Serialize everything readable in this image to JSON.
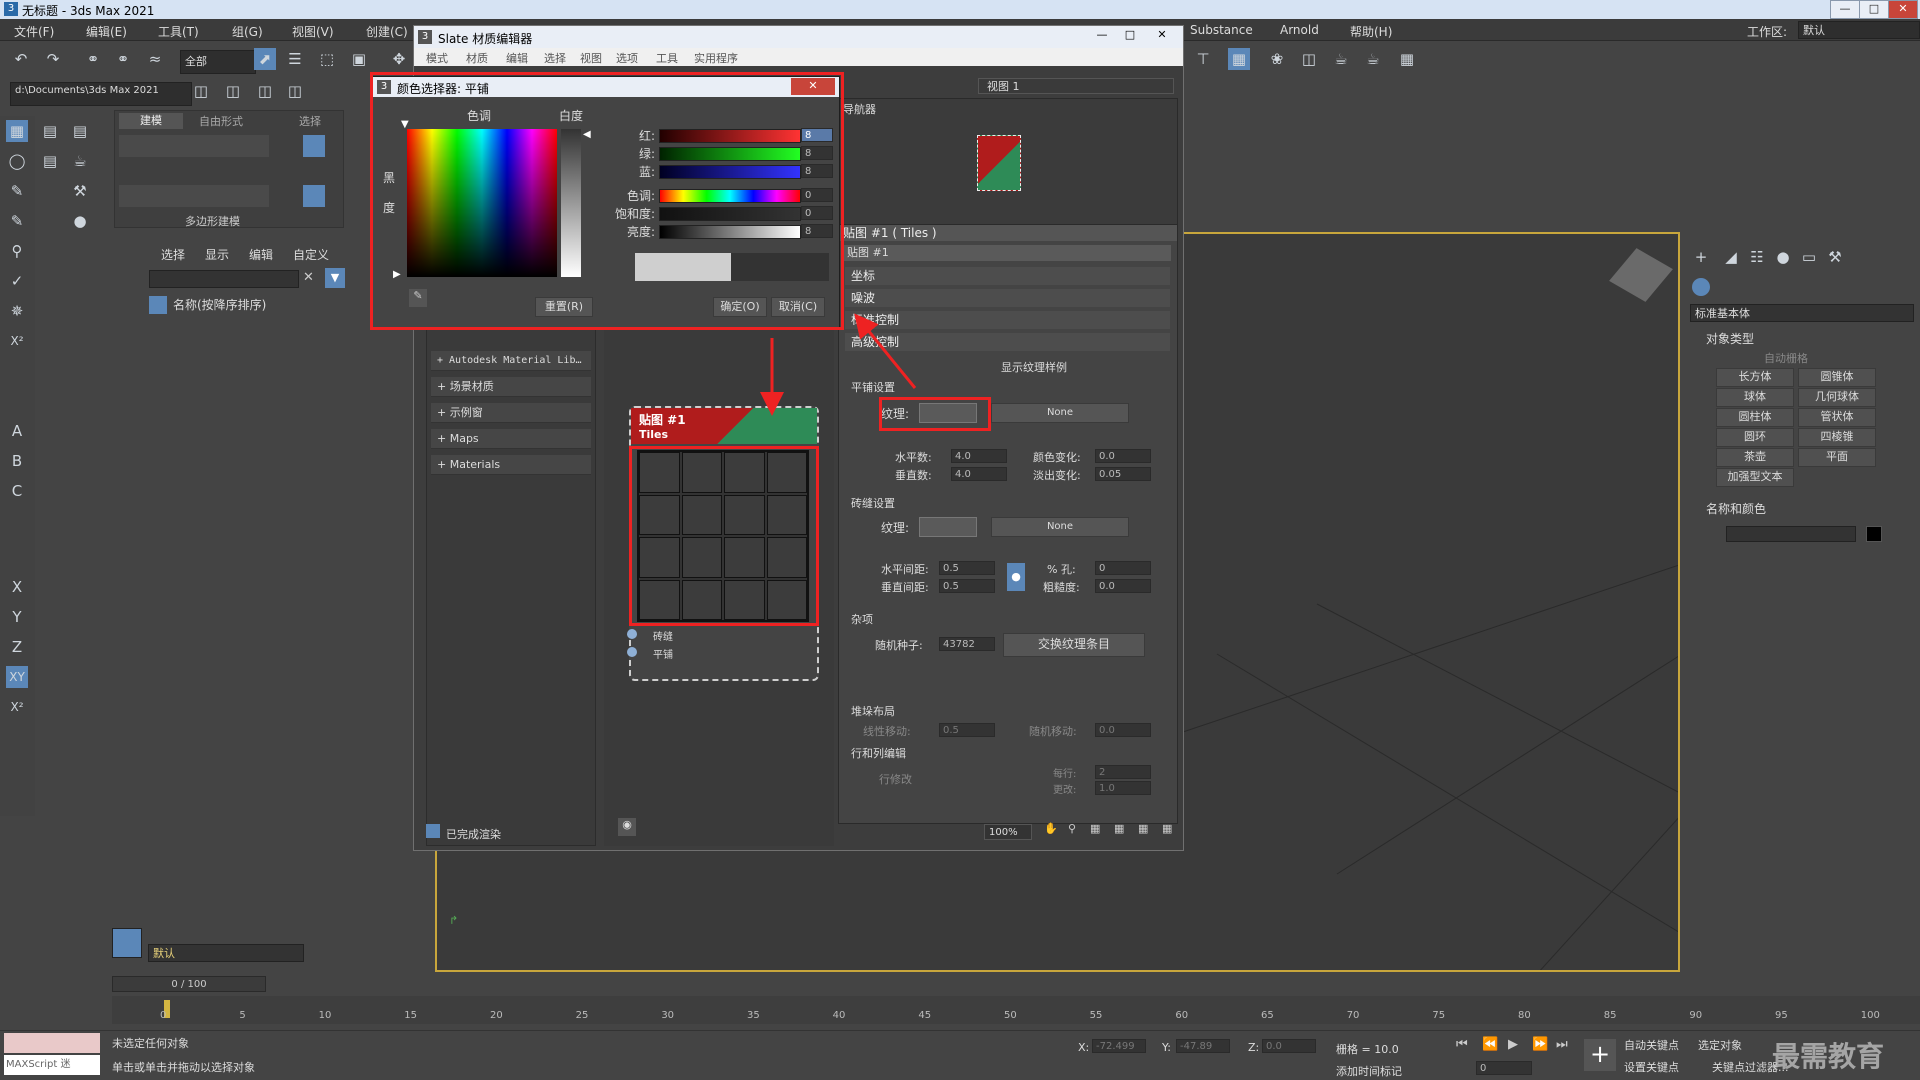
{
  "app": {
    "title": "无标题 - 3ds Max 2021",
    "workspace_label": "工作区:",
    "workspace_value": "默认"
  },
  "menu": [
    "文件(F)",
    "编辑(E)",
    "工具(T)",
    "组(G)",
    "视图(V)",
    "创建(C)",
    "Substance",
    "Arnold",
    "帮助(H)"
  ],
  "toolbar": {
    "selection_filter": "全部",
    "project_path": "d:\\Documents\\3ds Max 2021"
  },
  "ribbon": {
    "tabs": [
      "建模",
      "自由形式",
      "选择"
    ],
    "group_label": "多边形建模"
  },
  "explorer": {
    "tabs": [
      "选择",
      "显示",
      "编辑",
      "自定义"
    ],
    "column_header": "名称(按降序排序)",
    "layer": "默认"
  },
  "slate": {
    "title": "Slate 材质编辑器",
    "menu": [
      "模式",
      "材质",
      "编辑",
      "选择",
      "视图",
      "选项",
      "工具",
      "实用程序"
    ],
    "view_dropdown": "视图 1",
    "navigator_label": "导航器",
    "browser_items": [
      "+ Autodesk Material Lib…",
      "+ 场景材质",
      "+ 示例窗",
      "+ Maps",
      "+ Materials"
    ],
    "node": {
      "title": "贴图 #1",
      "subtitle": "Tiles",
      "slot1": "砖缝",
      "slot2": "平铺"
    },
    "status": "已完成渲染",
    "zoom": "100%"
  },
  "params": {
    "header": "贴图 #1 ( Tiles )",
    "map_name": "贴图 #1",
    "rollouts": [
      "坐标",
      "噪波",
      "标准控制",
      "高级控制"
    ],
    "show_texture_swatches": "显示纹理样例",
    "tile_setup": "平铺设置",
    "texture_label": "纹理:",
    "none_label": "None",
    "h_count_label": "水平数:",
    "h_count": "4.0",
    "v_count_label": "垂直数:",
    "v_count": "4.0",
    "color_var_label": "颜色变化:",
    "color_var": "0.0",
    "fade_var_label": "淡出变化:",
    "fade_var": "0.05",
    "grout_setup": "砖缝设置",
    "grout_texture_label": "纹理:",
    "h_gap_label": "水平间距:",
    "h_gap": "0.5",
    "v_gap_label": "垂直间距:",
    "v_gap": "0.5",
    "holes_label": "% 孔:",
    "holes": "0",
    "rough_label": "粗糙度:",
    "rough": "0.0",
    "misc": "杂项",
    "seed_label": "随机种子:",
    "seed": "43782",
    "swap_button": "交换纹理条目",
    "stacking": "堆垛布局",
    "line_shift_label": "线性移动:",
    "line_shift": "0.5",
    "random_shift_label": "随机移动:",
    "random_shift": "0.0",
    "row_col_edit": "行和列编辑",
    "row_modify": "行修改",
    "per_row_label": "每行:",
    "per_row": "2",
    "change_label": "更改:",
    "change": "1.0"
  },
  "color_picker": {
    "title": "颜色选择器: 平铺",
    "hue_label": "色调",
    "whiteness_label": "白度",
    "black_label_1": "黑",
    "black_label_2": "度",
    "channels": [
      {
        "label": "红:",
        "value": "8"
      },
      {
        "label": "绿:",
        "value": "8"
      },
      {
        "label": "蓝:",
        "value": "8"
      },
      {
        "label": "色调:",
        "value": "0"
      },
      {
        "label": "饱和度:",
        "value": "0"
      },
      {
        "label": "亮度:",
        "value": "8"
      }
    ],
    "reset": "重置(R)",
    "ok": "确定(O)",
    "cancel": "取消(C)"
  },
  "command_panel": {
    "dropdown": "标准基本体",
    "object_type": "对象类型",
    "autogrid": "自动栅格",
    "buttons": [
      "长方体",
      "圆锥体",
      "球体",
      "几何球体",
      "圆柱体",
      "管状体",
      "圆环",
      "四棱锥",
      "茶壶",
      "平面",
      "加强型文本"
    ],
    "name_color": "名称和颜色"
  },
  "timeline": {
    "frame_counter": "0 / 100",
    "ticks": [
      "0",
      "5",
      "10",
      "15",
      "20",
      "25",
      "30",
      "35",
      "40",
      "45",
      "50",
      "55",
      "60",
      "65",
      "70",
      "75",
      "80",
      "85",
      "90",
      "95",
      "100"
    ]
  },
  "status": {
    "maxscript": "MAXScript 迷",
    "line1": "未选定任何对象",
    "line2": "单击或单击并拖动以选择对象",
    "x_label": "X:",
    "x": "-72.499",
    "y_label": "Y:",
    "y": "-47.89",
    "z_label": "Z:",
    "z": "0.0",
    "grid": "栅格 = 10.0",
    "add_time_tag": "添加时间标记",
    "auto_key": "自动关键点",
    "selected": "选定对象",
    "set_key": "设置关键点",
    "key_filter": "关键点过滤器...",
    "frame": "0"
  },
  "watermark": "最需教育",
  "colors": {
    "highlight": "#e22222",
    "node_red": "#b01c1c",
    "node_green": "#2e8b57",
    "viewport_border": "#c8a63c"
  }
}
